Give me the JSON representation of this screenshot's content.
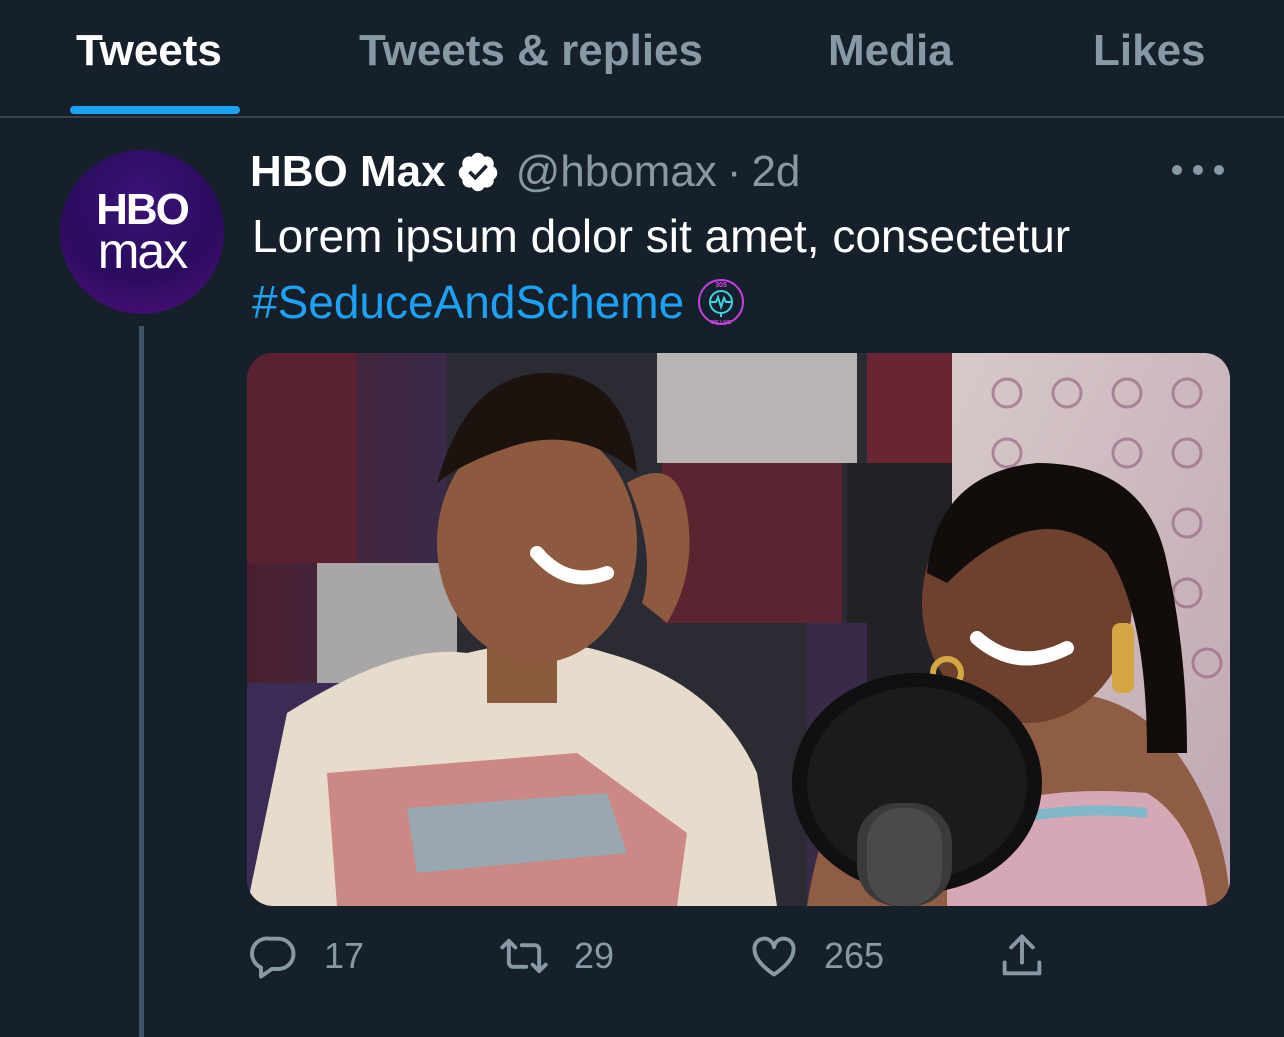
{
  "tabs": [
    {
      "label": "Tweets",
      "active": true
    },
    {
      "label": "Tweets & replies",
      "active": false
    },
    {
      "label": "Media",
      "active": false
    },
    {
      "label": "Likes",
      "active": false
    }
  ],
  "tweet": {
    "avatar": {
      "line1": "HBO",
      "line2": "max"
    },
    "name": "HBO Max",
    "verified_icon": "verified-badge-icon",
    "handle": "@hbomax",
    "separator": "·",
    "time": "2d",
    "more_icon": "more-horizontal-icon",
    "text": "Lorem ipsum dolor sit amet, consectetur",
    "hashtag": "#SeduceAndScheme",
    "hashflag_icon": "305-we-live-hashflag-icon",
    "hashflag_text_top": "305",
    "hashflag_text_bottom": "WE LIVE",
    "media_description": "photo-two-women-smiling-in-recording-studio",
    "actions": {
      "reply": {
        "icon": "reply-icon",
        "count": "17"
      },
      "retweet": {
        "icon": "retweet-icon",
        "count": "29"
      },
      "like": {
        "icon": "heart-icon",
        "count": "265"
      },
      "share": {
        "icon": "share-icon"
      }
    }
  },
  "colors": {
    "background": "#15202b",
    "accent": "#1da1f2",
    "secondary_text": "#8899a6",
    "divider": "#38444d"
  }
}
